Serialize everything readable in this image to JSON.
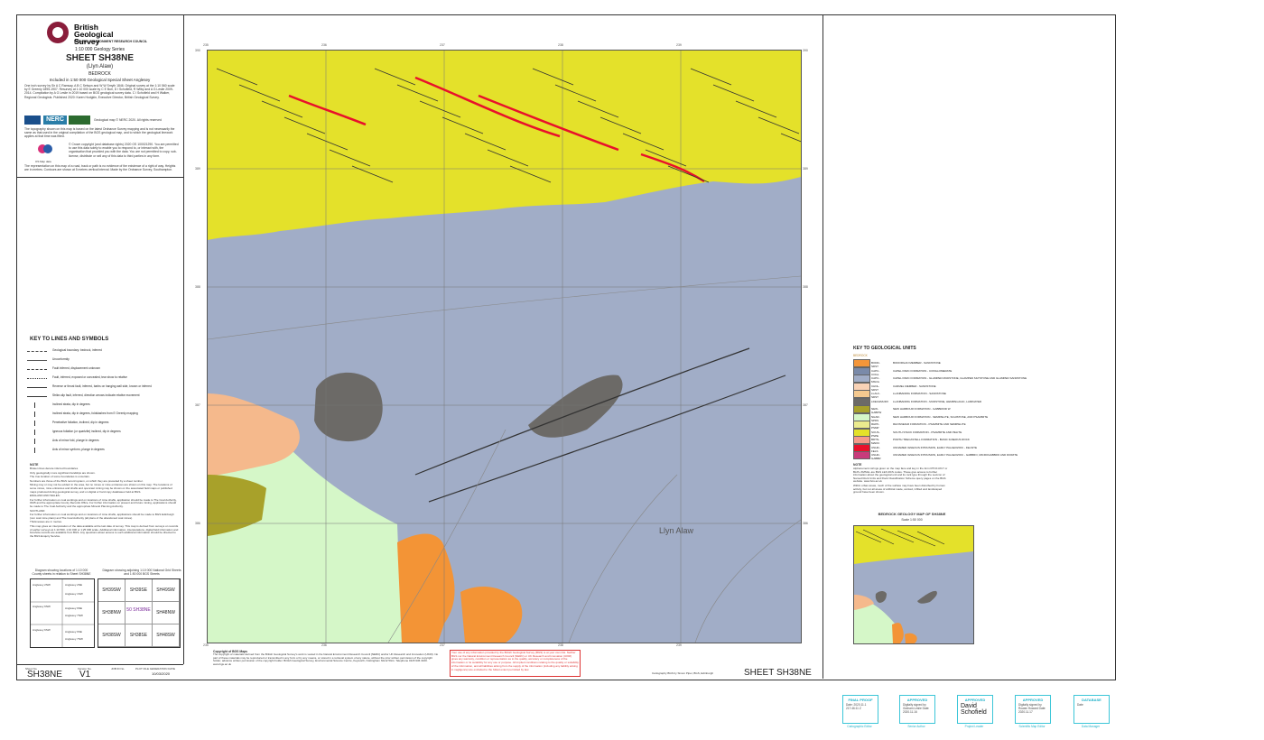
{
  "header": {
    "org_name": "British Geological Survey",
    "org_sub": "NATURAL ENVIRONMENT RESEARCH COUNCIL",
    "series": "1:10 000 Geology Series",
    "sheet_title": "SHEET SH38NE",
    "sheet_name": "(Llyn Alaw)",
    "theme": "BEDROCK",
    "included_in": "Included in 1:50 000 Geological Special Sheet Anglesey",
    "survey_notes": "One inch survey by Sir A C Ramsay, A B C Selwyn and W W Smyth 1846. Original survey at the 1:10 560 scale by E Greenly 1895-1907. Resurvey at 1:10 000 scale by C E Buri, D I Schofield, R Wilby and A G Leslie 2009-2014. Compilation by A G Leslie in 2019 based on BGS geological survey data. C I Schofield and H Walker, Regional Geologists. Published 2020: Karen Hodgkin, Executive Director, British Geological Survey.",
    "copyright_line": "Geological map © NERC 2020. All rights reserved",
    "topo_note": "The topography shown on this map is based on the latest Ordnance Survey mapping and is not necessarily the same as that used in the original compilation of the BGS geological map, and to which the geological linework applies at that time was fitted.",
    "crown_note": "© Crown copyright (and database rights) 2020 OS 100021290. You are permitted to use this data solely to enable you to respond to, or interact with, the organisation that provided you with the data. You are not permitted to copy, sub-license, distribute or sell any of this data to third parties in any form.",
    "rights_note": "The representation on this map of a road, track or path is no evidence of the existence of a right of way. Heights are in metres. Contours are shown at 5 metres vertical interval. Made by the Ordnance Survey, Southampton.",
    "nerc_label": "NERC",
    "os_label": "OS Map data"
  },
  "key_lines": {
    "title": "KEY TO LINES AND SYMBOLS",
    "items": [
      "Geological boundary: bedrock, inferred",
      "Unconformity",
      "Fault inferred, displacement unknown",
      "Fault, inferred, exposed or concealed, tear show to relative",
      "Reverse or thrust fault, inferred, barbs on hanging wall side, known or inferred",
      "Strike-slip fault, inferred, direction arrows indicate relative movement",
      "Inclined strata, dip in degrees",
      "Inclined strata, dip in degrees, foldslashes from E Greenly mapping",
      "Penetrative foliation, inclined, dip in degrees",
      "Igneous foliation (or quartzite) inclined, dip in degrees",
      "Axis of minor fold, plunge in degrees",
      "Axis of minor synform, plunge in degrees"
    ],
    "note_title": "NOTE",
    "note_lines": [
      "Broken lines denote inferred boundaries",
      "Only geologically more significant landslips are shown.",
      "The true location of some boundaries is uncertain.",
      "Numbers are those of the BGS record system, on which they are preceded by a sheet number.",
      "Mining may or may not be evident in the area, but no mines or mine entrances are shown on this map. The locations of some mines, mine entrances and shafts and opencast mining may be shown on the associated field maps or published maps produced during geological survey, and on digital or hard copy databases held at BGS.",
      "ENGLAND AND WALES:",
      "For further information on coal workings and on locations of mine shafts, application should be made to The Coal Authority, 0345 and the appropriate County Records Office. For further information on present and future mining, applications should be made to The Coal Authority and the appropriate Mineral Planning Authority.",
      "SCOTLAND:",
      "For further information on coal workings and on locations of mine shafts, applications should be made to BGS Edinburgh (non coal mine plans) and The Coal Authority (all plans of the abandoned coal mines).",
      "Thicknesses are in metres.",
      "This map gives an interpretation of the data available at the last date of survey. This map is derived from surveys on records of earlier surveys at 1:10 560, 1:10 000 or 1:25 000 scale. Additional information, interpretations, digital field information and borehole records are available from BGS. Any questions about access to such additional information should be directed to the BGS Enquiry Service."
    ],
    "diagram_left_title": "Diagram showing locations of 1:10 000 County sheets in relation to Sheet SH38NE",
    "diagram_right_title": "Diagram showing adjoining 1:10 000 National Grid Sheets and 1:50 000 BGS Sheets",
    "county_labels": [
      "Anglesey 2NW",
      "Anglesey 2NE",
      "Anglesey 1SW",
      "Anglesey 6NW",
      "Anglesey 6NE",
      "Anglesey 7NW",
      "Anglesey 6SW",
      "Anglesey 6SE",
      "Anglesey 7NW"
    ]
  },
  "sheet_grid": {
    "cells": [
      [
        "SH39SW",
        "SH39SE",
        "SH49SW"
      ],
      [
        "SH38NW",
        "SH38NE",
        "SH48NW"
      ],
      [
        "SH38SW",
        "SH38SE",
        "SH48SW"
      ]
    ],
    "center_note": "50"
  },
  "footer": {
    "sheet_no_label": "Sheet No.",
    "version_label": "Version No.",
    "job_label": "JOB ID No.",
    "plot_label": "PLOT FILE GENERATION DATE",
    "sheet_no": "SH38NE",
    "version": "V1",
    "plot_date": "10/03/2020",
    "big_sheet": "SHEET  SH38NE",
    "cartography": "Cartography BGS by Simon Piper, BGS, Edinburgh"
  },
  "copyright_block": {
    "title": "Copyright of BGS Maps",
    "text": "The copyright of materials derived from the British Geological Survey's work is vested in the Natural Environment Research Council [NERC] and/or UK Research and Innovation (UKRI). No part of these materials may be reproduced or transmitted in any form or by any means, or stored in a retrieval system of any nature, without the prior written permission of the copyright holder, advance written permission of the copyright holder. British Geological Survey, Environmental Science Centre, Keyworth, Nottingham NG12 5GG. Telephone 0115 936 3100. www.bgs.ac.uk"
  },
  "liability_notice": "Your use of any information provided by the British Geological Survey (BGS) is at your own risk. Neither BGS nor the Natural Environment Research Council (NERC) or UK Research and Innovation (UKRI) gives any warranty, condition or representation as to the quality, accuracy or completeness of the information or its suitability for any use or purpose. All implied conditions relating to the quality or suitability of the information, and all liabilities arising from the supply of the information (including any liability arising in negligence) are excluded to the fullest extent permitted by law.",
  "map": {
    "place_label": "Llyn Alaw",
    "grid_x": [
      "235",
      "236",
      "237",
      "238",
      "239"
    ],
    "grid_y": [
      "390",
      "389",
      "388",
      "387",
      "386"
    ],
    "colors": {
      "yellow": "#e4e12a",
      "grey_blue": "#a1adc7",
      "dark_grey": "#6c6a67",
      "salmon": "#f5b98c",
      "pale_green": "#d5f7c8",
      "olive": "#a8a12a",
      "orange": "#f39436",
      "red_dyke": "#e8102b",
      "magenta": "#c83b7b"
    }
  },
  "key_units": {
    "title": "KEY TO GEOLOGICAL UNITS",
    "section": "BEDROCK",
    "units": [
      {
        "code": "BODD-SDST",
        "name": "BODORGAN MEMBER - SANDSTONE",
        "color": "#f4963a"
      },
      {
        "code": "CAPC-COGL",
        "name": "CAPEL PARC FORMATION - CONGLOMERATE",
        "color": "#7a8aa9"
      },
      {
        "code": "CAPC-MSCG",
        "name": "CAPEL PARC FORMATION - GLAMPED MUDSTONE, GLAMPED SILTSTONE AND GLAMPED SANDSTONE",
        "color": "#a1adc7"
      },
      {
        "code": "CHNL-SDST",
        "name": "CARMEL MEMBER - SANDSTONE",
        "color": "#f9d2b6"
      },
      {
        "code": "LLALF-SDST",
        "name": "LLANBADRIG FORMATION - SANDSTONE",
        "color": "#f5c98f"
      },
      {
        "code": "LDECHMUDX",
        "name": "LLANBADRIG FORMATION - MUDSTONE, HEMIPELAGIC, LAMINATED",
        "color": "#6c6a67"
      },
      {
        "code": "NEW-GABPW",
        "name": "NEW HARBOUR FORMATION - GABBROID W",
        "color": "#a8a12a"
      },
      {
        "code": "NHAR-SPDS",
        "name": "NEW HARBOUR FORMATION - SEMIPELITE, SCHISTOSE, AND PSAMMITE",
        "color": "#d5f7c8"
      },
      {
        "code": "RHPF-PSMP",
        "name": "RHOSNEIGR FORMATION - PSAMMITE AND SEMIPELITE",
        "color": "#ebeb8e"
      },
      {
        "code": "SOUS-PSPE",
        "name": "SOUTH STACK FORMATION - PSAMMITE AND PELITE",
        "color": "#e4e12a"
      },
      {
        "code": "BDTN-MAFIC",
        "name": "PORTH TRECASTELL FORMATION - BASIC IGNEOUS ROCK",
        "color": "#f59a8a"
      },
      {
        "code": "UNHD-FELS",
        "name": "UNNAMED IGNEOUS INTRUSION, EARLY PALAEOZOIC - FELSITE",
        "color": "#e8102b"
      },
      {
        "code": "UNHD-GABBR",
        "name": "UNNAMED IGNEOUS INTRUSION, EARLY PALAEOZOIC - GABBRO, MICROGABBRO AND DIORITE",
        "color": "#c83b7b"
      }
    ],
    "note_title": "NOTE",
    "note": "Alphanumeric strings given on the map face and key in the form RTCF-RCY or BLPL-XMSGL are BGS LEX-RCS codes. These give access to further information about the geological unit and its rock type through the Lexicon of Named Rock Units and Rock Classification Scheme query pages on the BGS website, www.bgs.ac.uk",
    "note2": "Within urban areas, much of the surface may have been disturbed by human activity, but not all areas of artificial made, worked, infilled and landscaped ground have been shown.",
    "inset_title": "BEDROCK GEOLOGY MAP OF SH38NE",
    "inset_scale": "Scale 1:50 000"
  },
  "stamps": [
    {
      "title": "FINAL PROOF",
      "body": "Date: 2020.11.1 217:46:11 Z",
      "caption": "Cartographic Editor"
    },
    {
      "title": "APPROVED",
      "body": "Digitally signed by Graham Leslie Date: 2020.11.16",
      "caption": "Senior Author"
    },
    {
      "title": "APPROVED",
      "body": "David Schofield",
      "caption": "Project Leader"
    },
    {
      "title": "APPROVED",
      "body": "Digitally signed by Rowan Howard Date: 2020.11.17",
      "caption": "Scientific Map Editor"
    },
    {
      "title": "DATABASE",
      "body": "Date",
      "caption": "Data Manager"
    }
  ]
}
